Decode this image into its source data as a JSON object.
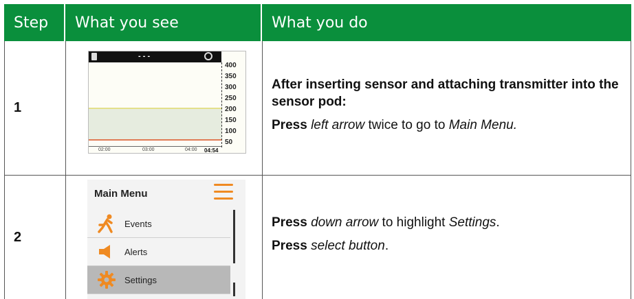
{
  "table": {
    "headers": {
      "step": "Step",
      "see": "What you see",
      "do": "What you do"
    },
    "rows": [
      {
        "step": "1",
        "instruction_heading": "After inserting sensor and attaching transmitter into the sensor pod:",
        "press_label": "Press",
        "press_target": "left arrow",
        "press_mid": " twice to go to ",
        "press_dest": "Main Menu."
      },
      {
        "step": "2",
        "line1_press": "Press",
        "line1_target": "down arrow",
        "line1_mid": " to highlight ",
        "line1_dest": "Settings",
        "line1_end": ".",
        "line2_press": "Press",
        "line2_target": "select button",
        "line2_end": "."
      }
    ]
  },
  "screen1": {
    "top_text": "- - -",
    "y_ticks": [
      "400",
      "350",
      "300",
      "250",
      "200",
      "150",
      "100",
      "50"
    ],
    "x_ticks": [
      "02:00",
      "03:00",
      "04:00"
    ],
    "time": "04:54",
    "colors": {
      "high_limit": "#e3e08a",
      "low_limit": "#e07a55",
      "target_zone": "#e6ecdf"
    }
  },
  "screen2": {
    "title": "Main Menu",
    "items": [
      {
        "label": "Events",
        "icon": "running-person-icon"
      },
      {
        "label": "Alerts",
        "icon": "speaker-icon"
      },
      {
        "label": "Settings",
        "icon": "gear-icon",
        "selected": true
      }
    ],
    "accent": "#ef8a22"
  },
  "colors": {
    "header_bg": "#0a8f3c",
    "header_text": "#ffffff"
  }
}
